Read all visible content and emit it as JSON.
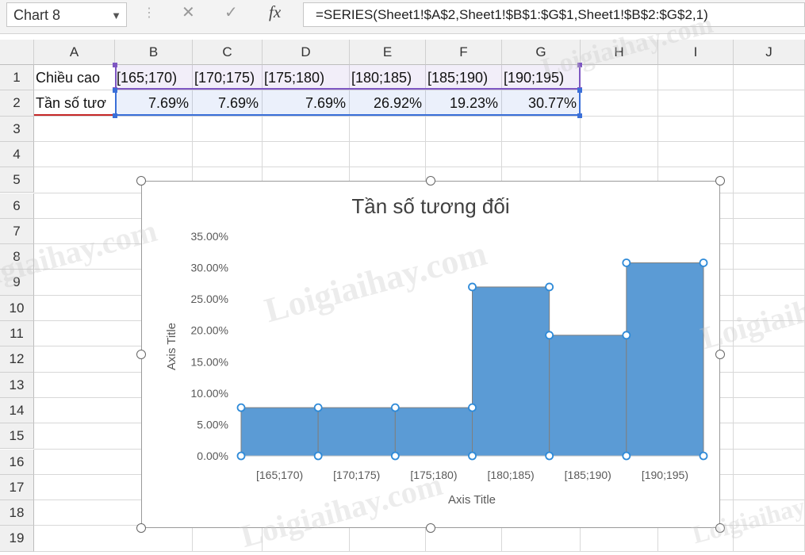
{
  "formula_bar": {
    "name_box": "Chart 8",
    "formula": "=SERIES(Sheet1!$A$2,Sheet1!$B$1:$G$1,Sheet1!$B$2:$G$2,1)"
  },
  "columns": [
    "A",
    "B",
    "C",
    "D",
    "E",
    "F",
    "G",
    "H",
    "I",
    "J"
  ],
  "rows": [
    "1",
    "2",
    "3",
    "4",
    "5",
    "6",
    "7",
    "8",
    "9",
    "10",
    "11",
    "12",
    "13",
    "14",
    "15",
    "16",
    "17",
    "18",
    "19"
  ],
  "cells": {
    "A1": "Chiều cao",
    "A2": "Tần số tươ",
    "row1": [
      "[165;170)",
      "[170;175)",
      "[175;180)",
      "[180;185)",
      "[185;190)",
      "[190;195)"
    ],
    "row2": [
      "7.69%",
      "7.69%",
      "7.69%",
      "26.92%",
      "19.23%",
      "30.77%"
    ]
  },
  "colors": {
    "bar_fill": "#5b9bd5",
    "category_range": "#7e57c2",
    "value_range": "#3a6fd8",
    "name_range": "#c62828"
  },
  "chart_data": {
    "type": "bar",
    "title": "Tần số tương đối",
    "xlabel": "Axis Title",
    "ylabel": "Axis Title",
    "categories": [
      "[165;170)",
      "[170;175)",
      "[175;180)",
      "[180;185)",
      "[185;190)",
      "[190;195)"
    ],
    "values": [
      7.69,
      7.69,
      7.69,
      26.92,
      19.23,
      30.77
    ],
    "y_ticks": [
      "0.00%",
      "5.00%",
      "10.00%",
      "15.00%",
      "20.00%",
      "25.00%",
      "30.00%",
      "35.00%"
    ],
    "ylim": [
      0,
      35
    ],
    "grid": false,
    "legend": "none"
  },
  "watermark": "Loigiaihay.com"
}
